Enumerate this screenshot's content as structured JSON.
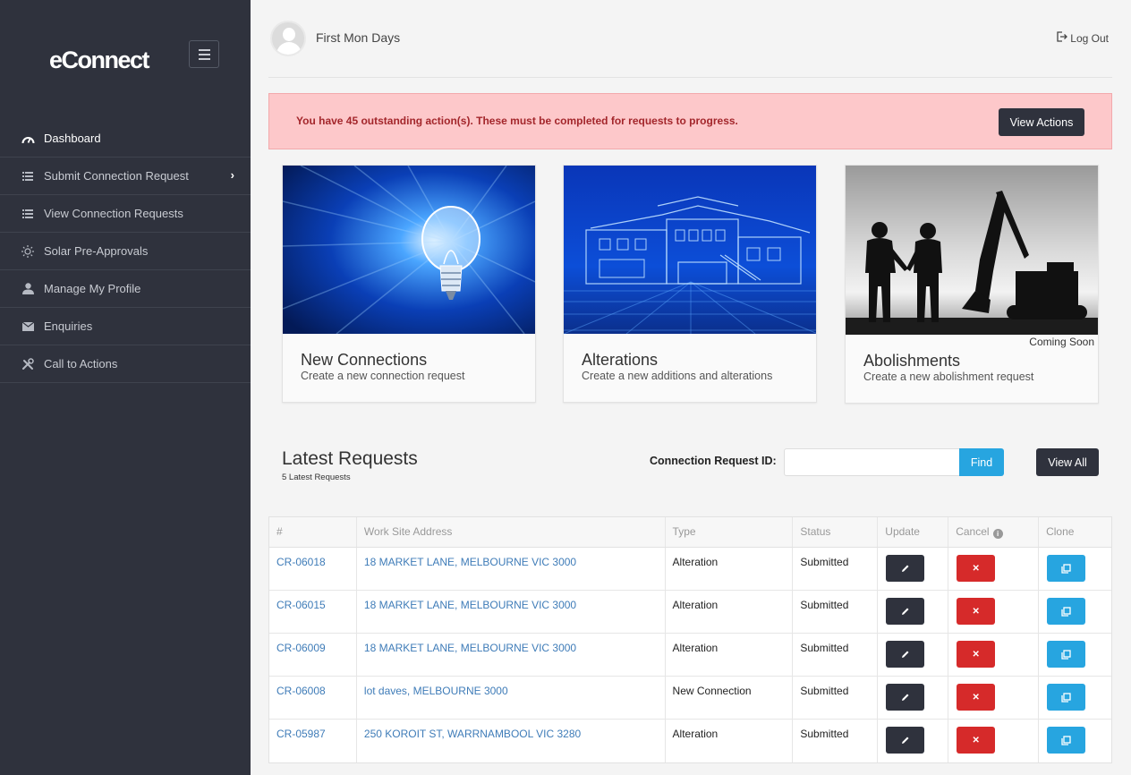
{
  "app": {
    "logo": "eConnect"
  },
  "sidebar": {
    "items": [
      {
        "label": "Dashboard",
        "icon": "gauge-icon"
      },
      {
        "label": "Submit Connection Request",
        "icon": "list-icon"
      },
      {
        "label": "View Connection Requests",
        "icon": "list-icon"
      },
      {
        "label": "Solar Pre-Approvals",
        "icon": "sun-icon"
      },
      {
        "label": "Manage My Profile",
        "icon": "user-icon"
      },
      {
        "label": "Enquiries",
        "icon": "envelope-icon"
      },
      {
        "label": "Call to Actions",
        "icon": "tools-icon"
      }
    ]
  },
  "header": {
    "username": "First Mon Days",
    "logout_label": "Log Out"
  },
  "alert": {
    "message": "You have 45 outstanding action(s). These must be completed for requests to progress.",
    "button_label": "View Actions"
  },
  "cards": [
    {
      "title": "New Connections",
      "subtitle": "Create a new connection request"
    },
    {
      "title": "Alterations",
      "subtitle": "Create a new additions and alterations"
    },
    {
      "title": "Abolishments",
      "subtitle": "Create a new abolishment request",
      "badge": "Coming Soon"
    }
  ],
  "latest": {
    "title": "Latest Requests",
    "subtitle": "5 Latest Requests",
    "search_label": "Connection Request ID:",
    "search_value": "",
    "find_label": "Find",
    "view_all_label": "View All"
  },
  "table": {
    "headers": [
      "#",
      "Work Site Address",
      "Type",
      "Status",
      "Update",
      "Cancel",
      "Clone"
    ],
    "rows": [
      {
        "id": "CR-06018",
        "address": "18 MARKET LANE, MELBOURNE VIC 3000",
        "type": "Alteration",
        "status": "Submitted"
      },
      {
        "id": "CR-06015",
        "address": "18 MARKET LANE, MELBOURNE VIC 3000",
        "type": "Alteration",
        "status": "Submitted"
      },
      {
        "id": "CR-06009",
        "address": "18 MARKET LANE, MELBOURNE VIC 3000",
        "type": "Alteration",
        "status": "Submitted"
      },
      {
        "id": "CR-06008",
        "address": "lot daves, MELBOURNE 3000",
        "type": "New Connection",
        "status": "Submitted"
      },
      {
        "id": "CR-05987",
        "address": "250 KOROIT ST, WARRNAMBOOL VIC 3280",
        "type": "Alteration",
        "status": "Submitted"
      }
    ]
  },
  "colors": {
    "sidebar_bg": "#2f323d",
    "alert_bg": "#fdc8ca",
    "alert_text": "#a3262b",
    "accent_blue": "#27a5e0",
    "danger_red": "#d62a2a",
    "link_blue": "#3f7cb8"
  }
}
